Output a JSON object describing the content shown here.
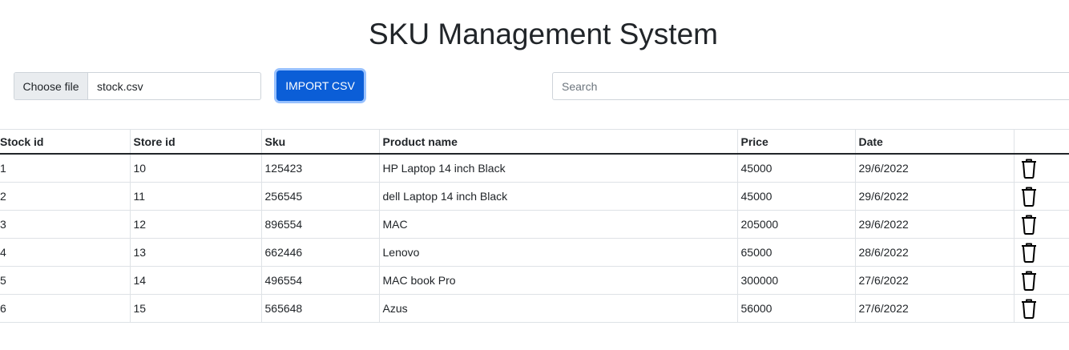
{
  "title": "SKU Management System",
  "file_input": {
    "button_label": "Choose file",
    "file_name": "stock.csv"
  },
  "import_button": {
    "label": "IMPORT CSV",
    "color": "#0b5ed7"
  },
  "search": {
    "placeholder": "Search",
    "value": ""
  },
  "table": {
    "headers": [
      "Stock id",
      "Store id",
      "Sku",
      "Product name",
      "Price",
      "Date",
      ""
    ],
    "rows": [
      {
        "stock_id": "1",
        "store_id": "10",
        "sku": "125423",
        "product_name": "HP Laptop 14 inch Black",
        "price": "45000",
        "date": "29/6/2022",
        "action_icon": "trash-icon"
      },
      {
        "stock_id": "2",
        "store_id": "11",
        "sku": "256545",
        "product_name": "dell Laptop 14 inch Black",
        "price": "45000",
        "date": "29/6/2022",
        "action_icon": "trash-icon"
      },
      {
        "stock_id": "3",
        "store_id": "12",
        "sku": "896554",
        "product_name": "MAC",
        "price": "205000",
        "date": "29/6/2022",
        "action_icon": "trash-icon"
      },
      {
        "stock_id": "4",
        "store_id": "13",
        "sku": "662446",
        "product_name": "Lenovo",
        "price": "65000",
        "date": "28/6/2022",
        "action_icon": "trash-icon"
      },
      {
        "stock_id": "5",
        "store_id": "14",
        "sku": "496554",
        "product_name": "MAC book Pro",
        "price": "300000",
        "date": "27/6/2022",
        "action_icon": "trash-icon"
      },
      {
        "stock_id": "6",
        "store_id": "15",
        "sku": "565648",
        "product_name": "Azus",
        "price": "56000",
        "date": "27/6/2022",
        "action_icon": "trash-icon"
      }
    ]
  }
}
